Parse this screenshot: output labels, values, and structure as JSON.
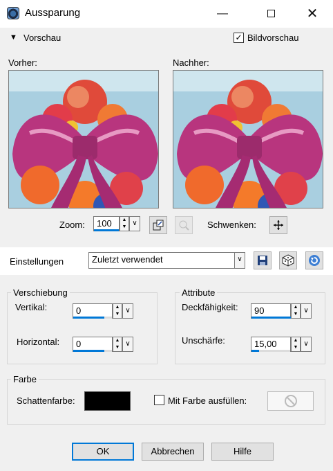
{
  "window": {
    "title": "Aussparung"
  },
  "preview_toggle": {
    "label": "Vorschau",
    "bildvorschau_label": "Bildvorschau",
    "bildvorschau_checked": true
  },
  "before": {
    "label": "Vorher:"
  },
  "after": {
    "label": "Nachher:"
  },
  "zoom": {
    "label": "Zoom:",
    "value": "100"
  },
  "pan": {
    "label": "Schwenken:"
  },
  "settings": {
    "label": "Einstellungen",
    "value": "Zuletzt verwendet"
  },
  "offset_group": {
    "title": "Verschiebung",
    "vertical": {
      "label": "Vertikal:",
      "value": "0"
    },
    "horizontal": {
      "label": "Horizontal:",
      "value": "0"
    }
  },
  "attributes_group": {
    "title": "Attribute",
    "opacity": {
      "label": "Deckfähigkeit:",
      "value": "90"
    },
    "blur": {
      "label": "Unschärfe:",
      "value": "15,00"
    }
  },
  "color_group": {
    "title": "Farbe",
    "shadow_label": "Schattenfarbe:",
    "shadow_color": "#000000",
    "fill_label": "Mit Farbe ausfüllen:",
    "fill_checked": false
  },
  "buttons": {
    "ok": "OK",
    "cancel": "Abbrechen",
    "help": "Hilfe"
  },
  "colors": {
    "accent": "#0078d7",
    "bow_pink": "#b8357e"
  }
}
